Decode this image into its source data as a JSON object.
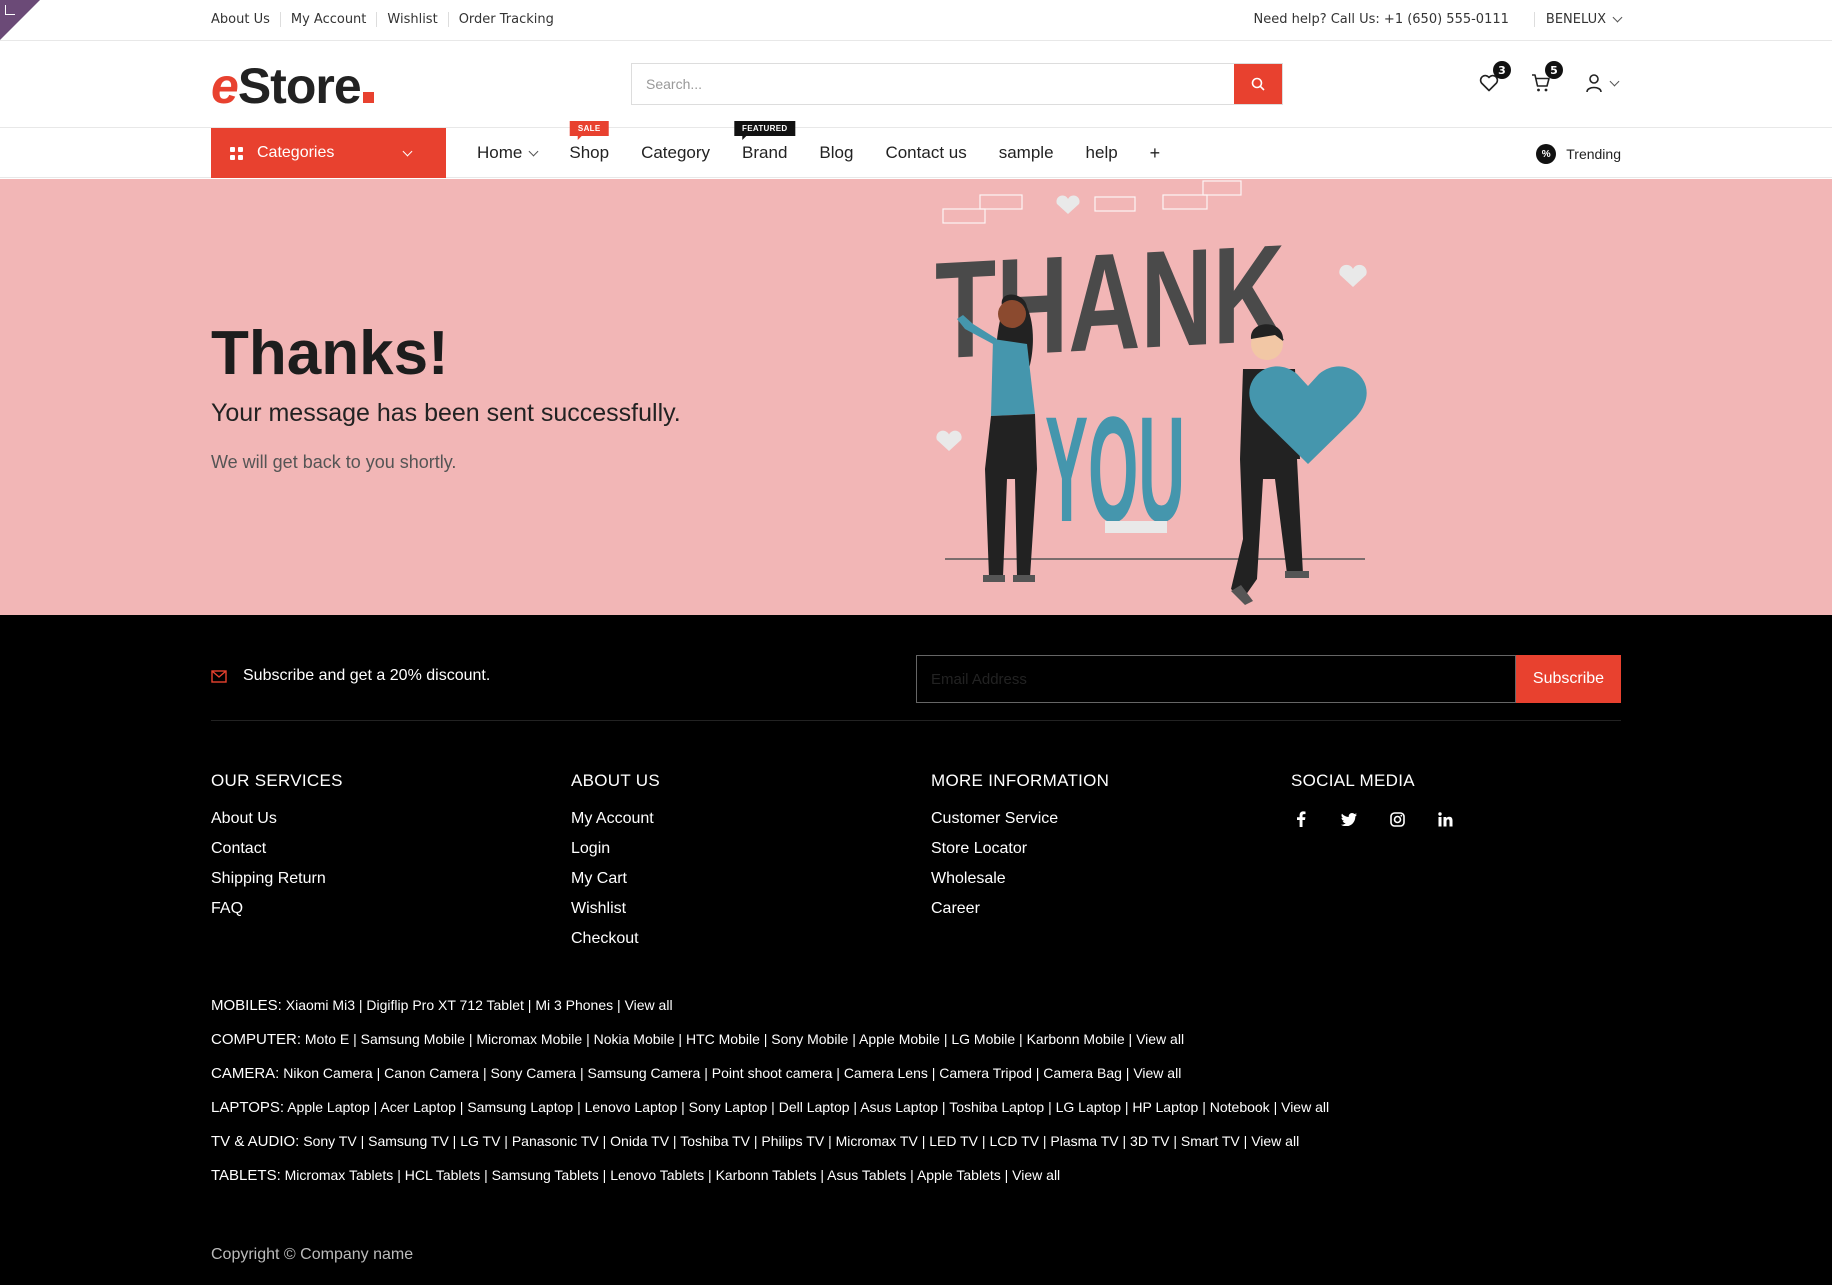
{
  "topbar": {
    "links": [
      "About Us",
      "My Account",
      "Wishlist",
      "Order Tracking"
    ],
    "help_text": "Need help? Call Us: +1 (650) 555-0111",
    "region": "BENELUX"
  },
  "header": {
    "logo_e": "e",
    "logo_rest": "Store",
    "search_placeholder": "Search...",
    "wishlist_count": "3",
    "cart_count": "5"
  },
  "nav": {
    "categories_label": "Categories",
    "items": [
      {
        "label": "Home",
        "dropdown": true
      },
      {
        "label": "Shop",
        "tag": "SALE"
      },
      {
        "label": "Category"
      },
      {
        "label": "Brand",
        "tag": "FEATURED"
      },
      {
        "label": "Blog"
      },
      {
        "label": "Contact us"
      },
      {
        "label": "sample"
      },
      {
        "label": "help"
      }
    ],
    "plus": "+",
    "trending_label": "Trending",
    "trending_icon_text": "%"
  },
  "hero": {
    "title": "Thanks!",
    "subtitle": "Your message has been sent successfully.",
    "note": "We will get back to you shortly.",
    "illustration_word1": "THANK",
    "illustration_word2": "YOU"
  },
  "footer": {
    "subscribe_text": "Subscribe and get a 20% discount.",
    "email_placeholder": "Email Address",
    "subscribe_button": "Subscribe",
    "columns": [
      {
        "title": "OUR SERVICES",
        "items": [
          "About Us",
          "Contact",
          "Shipping Return",
          "FAQ"
        ]
      },
      {
        "title": "ABOUT US",
        "items": [
          "My Account",
          "Login",
          "My Cart",
          "Wishlist",
          "Checkout"
        ]
      },
      {
        "title": "MORE INFORMATION",
        "items": [
          "Customer Service",
          "Store Locator",
          "Wholesale",
          "Career"
        ]
      }
    ],
    "social_title": "SOCIAL MEDIA",
    "social_icons": [
      "facebook-icon",
      "twitter-icon",
      "instagram-icon",
      "linkedin-icon"
    ],
    "category_links": [
      {
        "label": "MOBILES:",
        "items": [
          "Xiaomi Mi3",
          "Digiflip Pro XT 712 Tablet",
          "Mi 3 Phones",
          "View all"
        ]
      },
      {
        "label": "COMPUTER:",
        "items": [
          "Moto E",
          "Samsung Mobile",
          "Micromax Mobile",
          "Nokia Mobile",
          "HTC Mobile",
          "Sony Mobile",
          "Apple Mobile",
          "LG Mobile",
          "Karbonn Mobile",
          "View all"
        ]
      },
      {
        "label": "CAMERA:",
        "items": [
          "Nikon Camera",
          "Canon Camera",
          "Sony Camera",
          "Samsung Camera",
          "Point shoot camera",
          "Camera Lens",
          "Camera Tripod",
          "Camera Bag",
          "View all"
        ]
      },
      {
        "label": "LAPTOPS:",
        "items": [
          "Apple Laptop",
          "Acer Laptop",
          "Samsung Laptop",
          "Lenovo Laptop",
          "Sony Laptop",
          "Dell Laptop",
          "Asus Laptop",
          "Toshiba Laptop",
          "LG Laptop",
          "HP Laptop",
          "Notebook",
          "View all"
        ]
      },
      {
        "label": "TV & AUDIO:",
        "items": [
          "Sony TV",
          "Samsung TV",
          "LG TV",
          "Panasonic TV",
          "Onida TV",
          "Toshiba TV",
          "Philips TV",
          "Micromax TV",
          "LED TV",
          "LCD TV",
          "Plasma TV",
          "3D TV",
          "Smart TV",
          "View all"
        ]
      },
      {
        "label": "TABLETS:",
        "items": [
          "Micromax Tablets",
          "HCL Tablets",
          "Samsung Tablets",
          "Lenovo Tablets",
          "Karbonn Tablets",
          "Asus Tablets",
          "Apple Tablets",
          "View all"
        ]
      }
    ],
    "copyright": "Copyright © Company name"
  },
  "colors": {
    "accent": "#e8412f",
    "hero_bg": "#f2b6b6",
    "footer_bg": "#000000",
    "illustration_teal": "#4596ad",
    "illustration_gray": "#4a4a4a"
  }
}
